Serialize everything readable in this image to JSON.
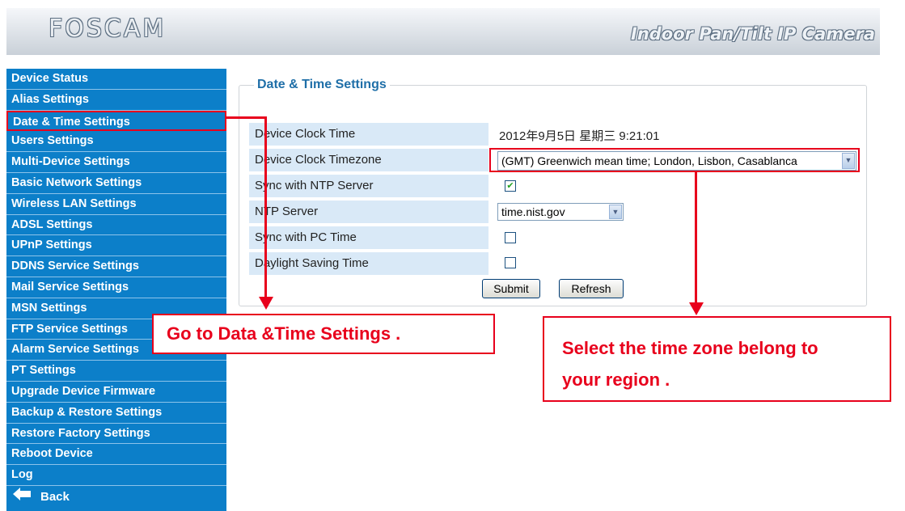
{
  "header": {
    "logo": "FOSCAM",
    "title": "Indoor Pan/Tilt IP Camera"
  },
  "sidebar": {
    "items": [
      {
        "label": "Device Status"
      },
      {
        "label": "Alias Settings"
      },
      {
        "label": "Date & Time Settings",
        "active": true
      },
      {
        "label": "Users Settings"
      },
      {
        "label": "Multi-Device Settings"
      },
      {
        "label": "Basic Network Settings"
      },
      {
        "label": "Wireless LAN Settings"
      },
      {
        "label": "ADSL Settings"
      },
      {
        "label": "UPnP Settings"
      },
      {
        "label": "DDNS Service Settings"
      },
      {
        "label": "Mail Service Settings"
      },
      {
        "label": "MSN Settings"
      },
      {
        "label": "FTP Service Settings"
      },
      {
        "label": "Alarm Service Settings"
      },
      {
        "label": "PT Settings"
      },
      {
        "label": "Upgrade Device Firmware"
      },
      {
        "label": "Backup & Restore Settings"
      },
      {
        "label": "Restore Factory Settings"
      },
      {
        "label": "Reboot Device"
      },
      {
        "label": "Log"
      }
    ],
    "back_label": "Back"
  },
  "settings": {
    "legend": "Date & Time Settings",
    "clock_label": "Device Clock Time",
    "clock_value": "2012年9月5日 星期三 9:21:01",
    "timezone_label": "Device Clock Timezone",
    "timezone_value": "(GMT) Greenwich mean time; London, Lisbon, Casablanca",
    "ntp_sync_label": "Sync with NTP Server",
    "ntp_sync_checked": true,
    "ntp_server_label": "NTP Server",
    "ntp_server_value": "time.nist.gov",
    "pc_sync_label": "Sync with PC Time",
    "pc_sync_checked": false,
    "dst_label": "Daylight Saving Time",
    "dst_checked": false,
    "submit_label": "Submit",
    "refresh_label": "Refresh"
  },
  "annotations": {
    "callout_left": "Go to Data &Time Settings .",
    "callout_right_line1": "Select the time zone belong to",
    "callout_right_line2": "your region ."
  },
  "colors": {
    "sidebar": "#0c7fc9",
    "annotation_red": "#e8001c",
    "label_bg": "#d9e9f7",
    "legend_blue": "#1f6fa8"
  }
}
